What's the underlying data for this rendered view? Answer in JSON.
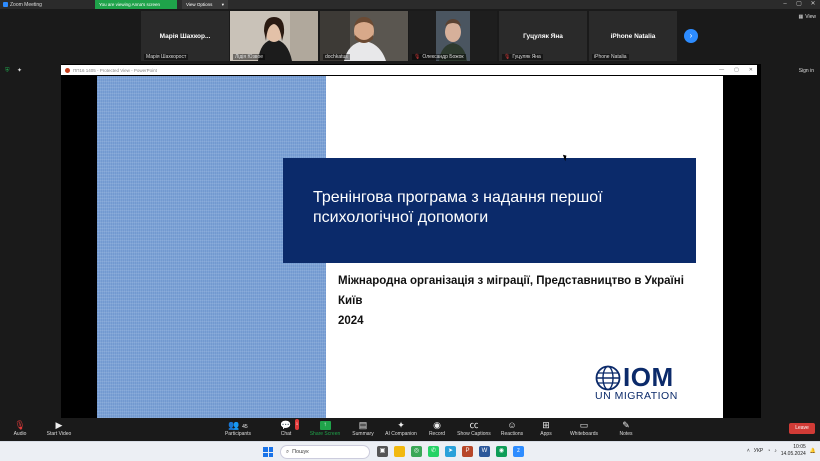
{
  "window": {
    "app_title": "Zoom Meeting",
    "viewing_badge": "You are viewing Anna's screen",
    "view_options_label": "View Options",
    "view_button": "View",
    "sign_in": "Sign in"
  },
  "participants": [
    {
      "center_name": "Марія  Шахкор...",
      "label": "Марія Шахкорост",
      "video": false,
      "muted": false
    },
    {
      "center_name": "",
      "label": "Лідія Юзвое",
      "video": true,
      "muted": false
    },
    {
      "center_name": "",
      "label": "dochkatus",
      "video": true,
      "muted": false
    },
    {
      "center_name": "",
      "label": "Олександр Божок",
      "video": true,
      "muted": true
    },
    {
      "center_name": "Гуцуляк Яна",
      "label": "Гуцуляк Яна",
      "video": false,
      "muted": true
    },
    {
      "center_name": "iPhone Natalia",
      "label": "iPhone Natalia",
      "video": false,
      "muted": false
    }
  ],
  "powerpoint": {
    "file_title": "ПП16 1405  -  Protected View - PowerPoint",
    "controls": [
      "—",
      "▢",
      "✕"
    ]
  },
  "slide": {
    "title_line1": "Тренінгова програма з надання першої",
    "title_line2": "психологічної допомоги",
    "org": "Міжнародна організація з міграції, Представництво в Україні",
    "city": "Київ",
    "year": "2024",
    "logo_main": "IOM",
    "logo_sub": "UN MIGRATION",
    "colors": {
      "title_bg": "#0b2a6a",
      "left_panel": "#7da3d6"
    }
  },
  "toolbar": {
    "audio": "Audio",
    "start_video": "Start Video",
    "participants": "Participants",
    "participants_count": "45",
    "chat": "Chat",
    "chat_badge": "1",
    "share_screen": "Share Screen",
    "summary": "Summary",
    "ai_companion": "AI Companion",
    "record": "Record",
    "show_captions": "Show Captions",
    "reactions": "Reactions",
    "apps": "Apps",
    "whiteboards": "Whiteboards",
    "notes": "Notes",
    "leave": "Leave"
  },
  "taskbar": {
    "search_placeholder": "Пошук",
    "language": "УКР",
    "time": "10:05",
    "date": "14.05.2024"
  }
}
